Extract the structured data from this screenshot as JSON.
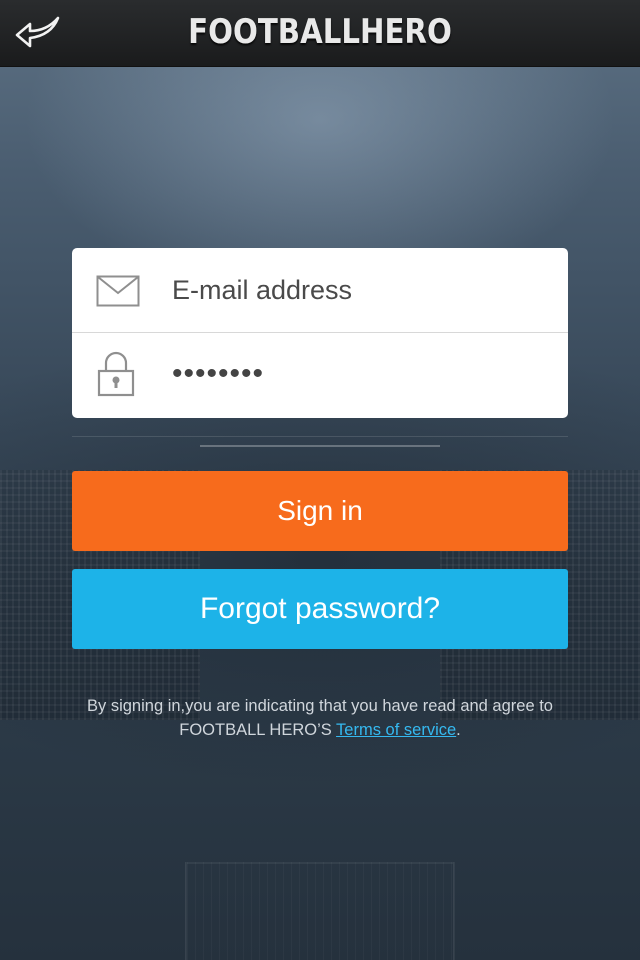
{
  "header": {
    "title": "FOOTBALLHERO",
    "back_icon": "back-arrow-icon"
  },
  "login": {
    "email": {
      "placeholder": "E-mail address",
      "value": "",
      "icon": "envelope-icon"
    },
    "password": {
      "value": "••••••••",
      "icon": "lock-icon"
    }
  },
  "buttons": {
    "signin_label": "Sign in",
    "forgot_label": "Forgot password?"
  },
  "legal": {
    "line1": "By signing in,you are indicating that you have read and agree to",
    "line2_prefix": "FOOTBALL HERO’S ",
    "terms_link": "Terms of service",
    "line2_suffix": "."
  },
  "colors": {
    "signin": "#f76b1c",
    "forgot": "#1db3e8",
    "link": "#35b9f0"
  }
}
